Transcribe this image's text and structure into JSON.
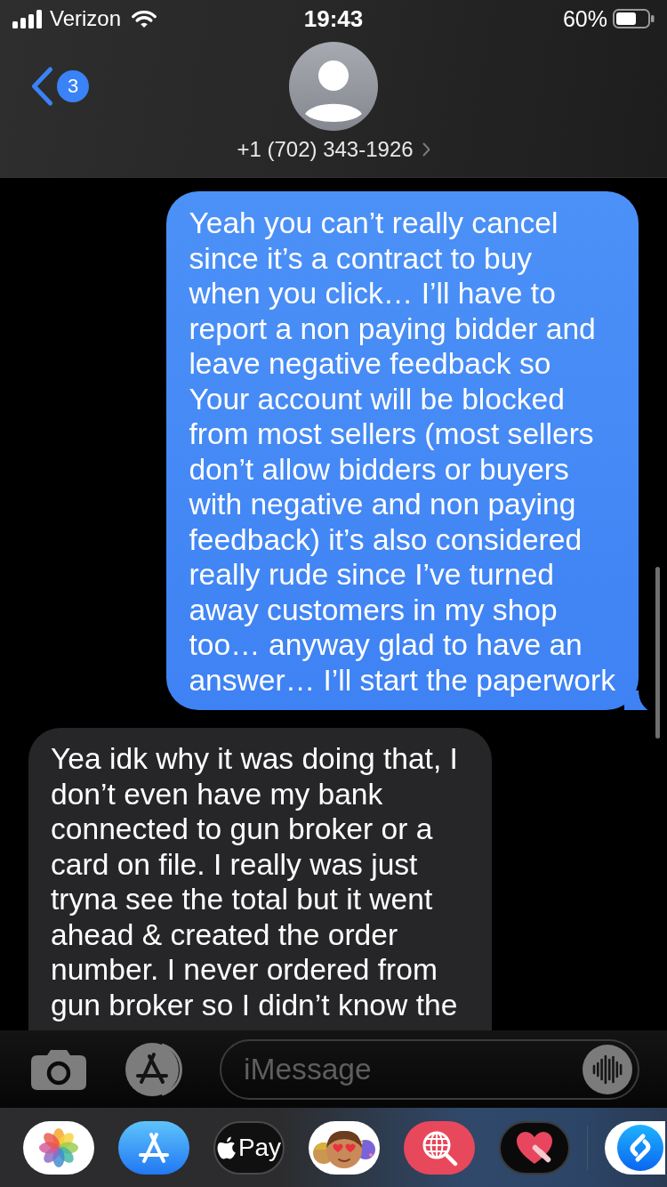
{
  "status_bar": {
    "carrier": "Verizon",
    "time": "19:43",
    "battery": "60%"
  },
  "header": {
    "unread_count": "3",
    "contact": "+1 (702) 343-1926"
  },
  "messages": [
    {
      "kind": "sent",
      "lines": [
        "Yeah you can’t really cancel",
        "since it’s a contract to buy",
        "when you click… I’ll have to",
        "report a non paying bidder and",
        "leave negative feedback so",
        "Your account will be blocked",
        "from most sellers (most sellers",
        "don’t allow bidders or buyers",
        "with negative and non paying",
        "feedback) it’s also considered",
        "really rude since I’ve turned",
        "away customers in my shop",
        "too… anyway glad to have an",
        "answer… I’ll start the paperwork"
      ]
    },
    {
      "kind": "received",
      "lines": [
        "Yea idk why it was doing that, I",
        "don’t even have my bank",
        "connected to gun broker or a",
        "card on file. I really was just",
        "tryna see the total but it went",
        "ahead & created the order",
        "number. I never ordered from",
        "gun broker so I didn’t know the"
      ]
    }
  ],
  "composer": {
    "placeholder": "iMessage"
  },
  "app_drawer": {
    "pay_label": "Pay"
  }
}
